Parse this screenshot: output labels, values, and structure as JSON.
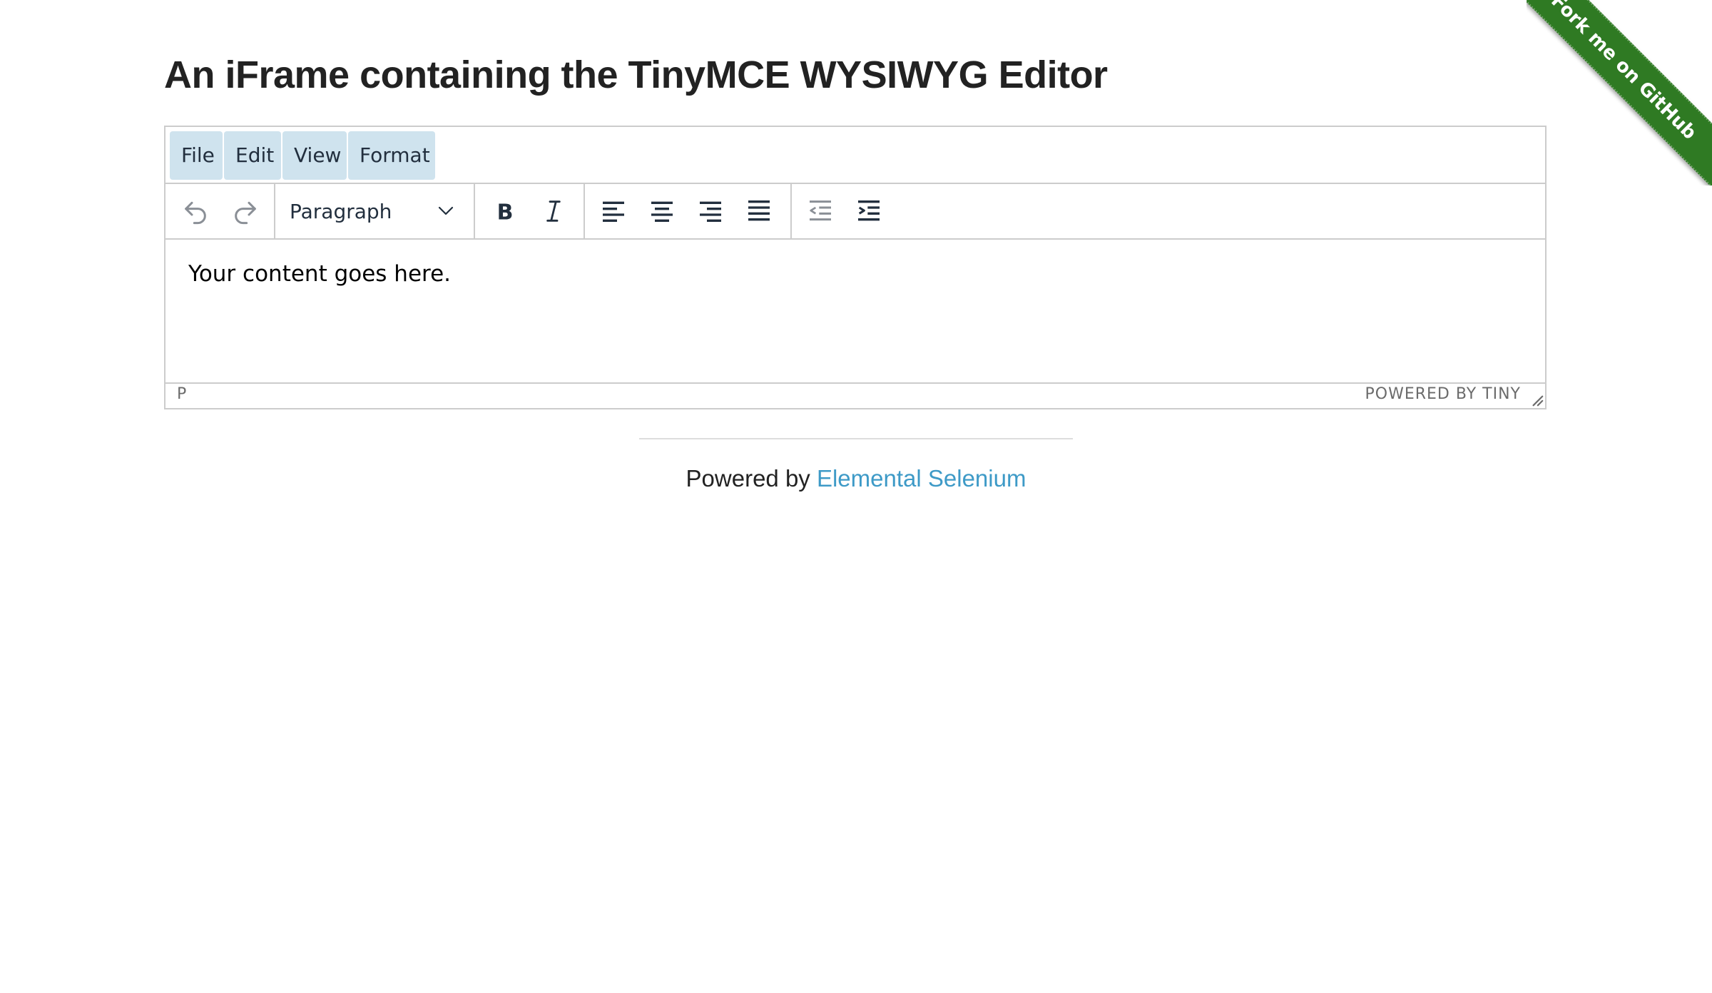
{
  "page": {
    "title": "An iFrame containing the TinyMCE WYSIWYG Editor",
    "ribbon_text": "Fork me on GitHub"
  },
  "editor": {
    "menubar": [
      "File",
      "Edit",
      "View",
      "Format"
    ],
    "toolbar": {
      "undo_icon": "undo-icon",
      "redo_icon": "redo-icon",
      "block_format": "Paragraph",
      "bold_icon": "bold-icon",
      "italic_icon": "italic-icon",
      "align_left_icon": "align-left-icon",
      "align_center_icon": "align-center-icon",
      "align_right_icon": "align-right-icon",
      "align_justify_icon": "align-justify-icon",
      "outdent_icon": "outdent-icon",
      "indent_icon": "indent-icon"
    },
    "content": "Your content goes here.",
    "status_path": "P",
    "branding": "POWERED BY TINY"
  },
  "footer": {
    "prefix": "Powered by ",
    "link_text": "Elemental Selenium"
  },
  "colors": {
    "menu_bg": "#cfe3ee",
    "ribbon": "#2f7a23",
    "link": "#3e9ac7",
    "icon_active": "#222f3e",
    "icon_disabled": "#8a8f96"
  }
}
